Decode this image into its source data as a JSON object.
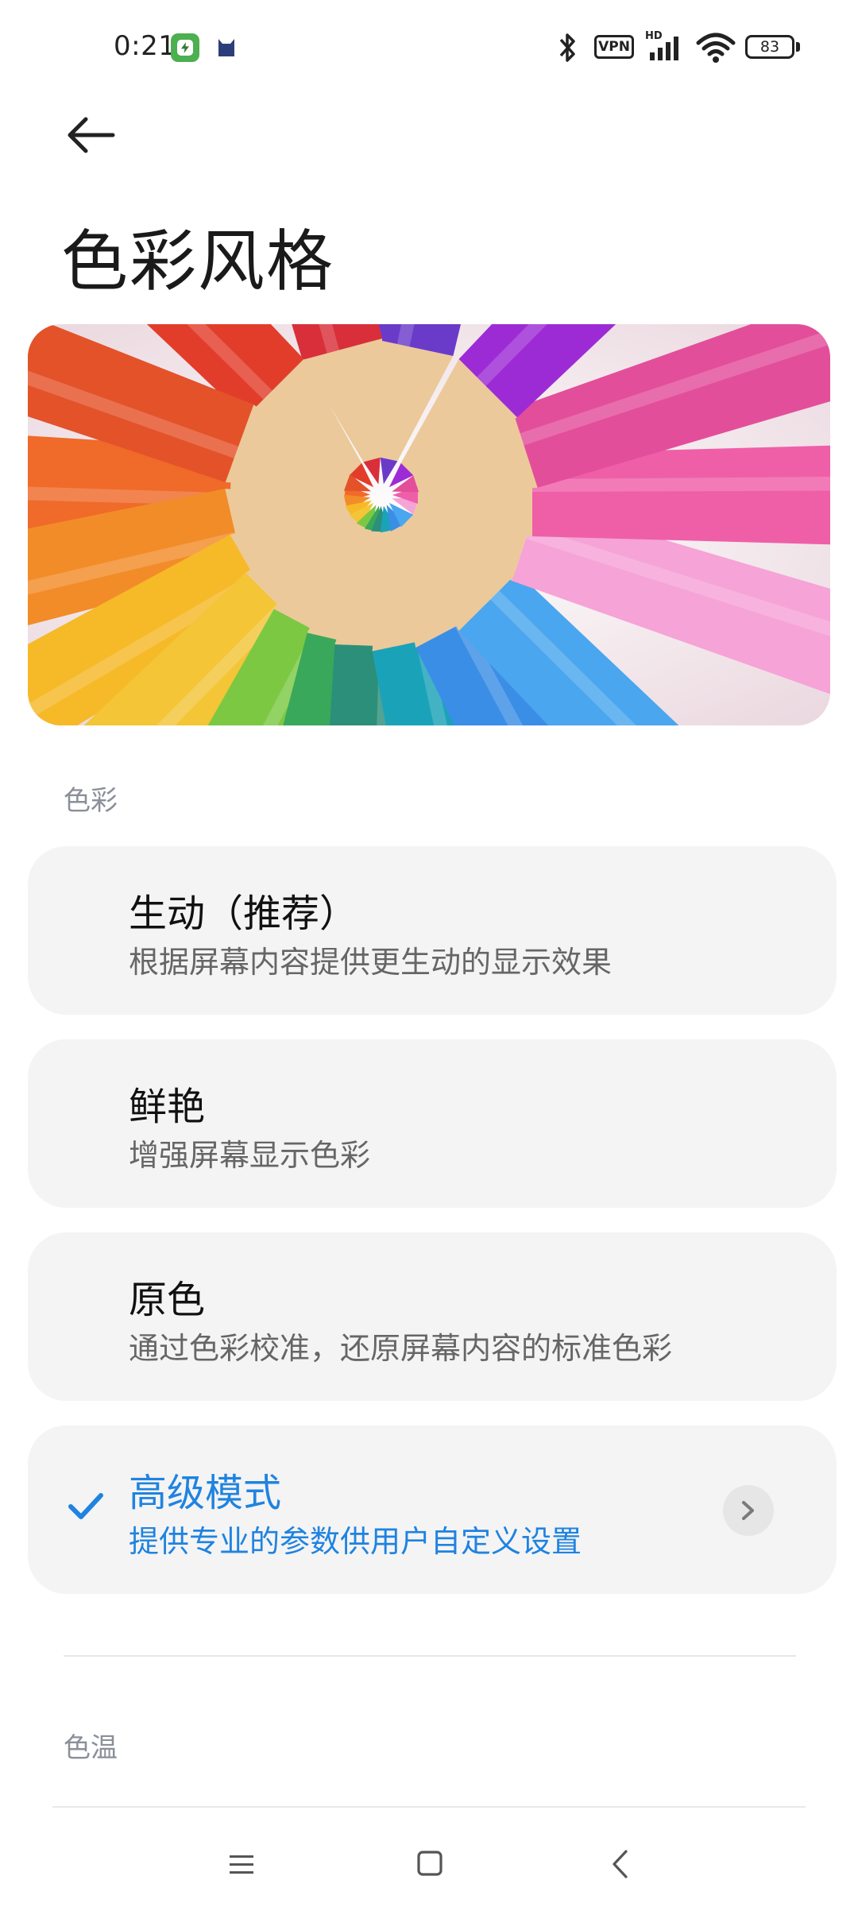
{
  "status_bar": {
    "time": "0:21",
    "vpn": "VPN",
    "hd": "HD",
    "battery": "83"
  },
  "header": {
    "title": "色彩风格"
  },
  "sections": {
    "color_label": "色彩",
    "temperature_label": "色温"
  },
  "options": [
    {
      "title": "生动（推荐）",
      "desc": "根据屏幕内容提供更生动的显示效果",
      "selected": false
    },
    {
      "title": "鲜艳",
      "desc": "增强屏幕显示色彩",
      "selected": false
    },
    {
      "title": "原色",
      "desc": "通过色彩校准，还原屏幕内容的标准色彩",
      "selected": false
    },
    {
      "title": "高级模式",
      "desc": "提供专业的参数供用户自定义设置",
      "selected": true
    }
  ],
  "colors": {
    "accent": "#1f83e0",
    "card_bg": "#f4f4f4",
    "section_label": "#8a8f99"
  },
  "icons": {
    "back": "arrow-left-icon",
    "check": "check-icon",
    "chevron": "chevron-right-icon",
    "nav_menu": "menu-icon",
    "nav_home": "home-square-icon",
    "nav_back": "back-chevron-icon"
  }
}
